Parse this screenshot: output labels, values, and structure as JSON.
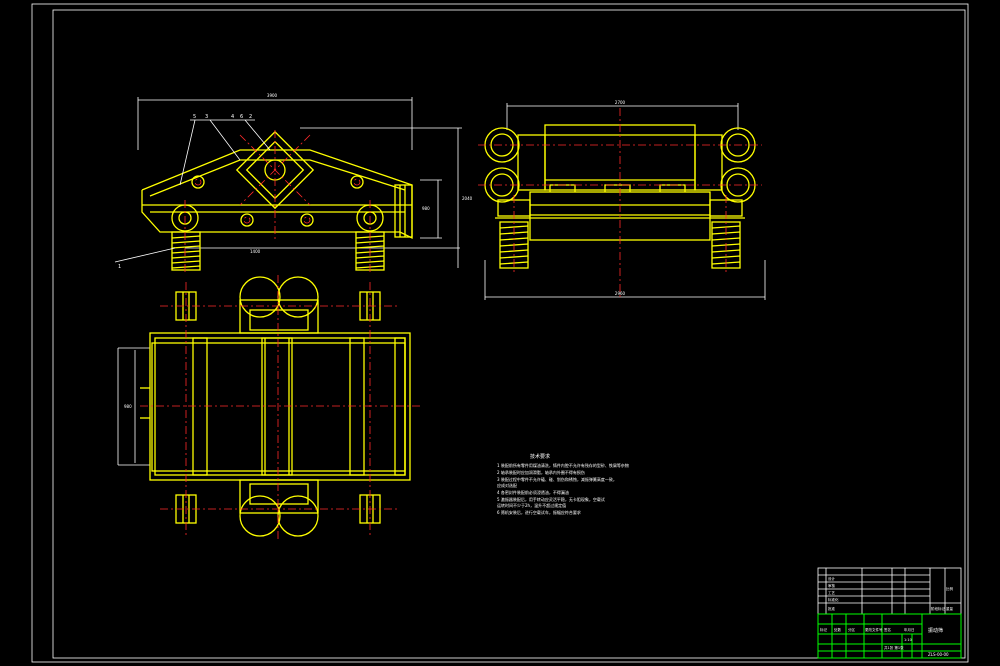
{
  "drawing": {
    "tech_title": "技术要求",
    "tech_notes": [
      "1  装配前所有零件用煤油清洗，铸件内腔不允许有残存的型砂、铁屑等杂物",
      "2  轴承装配时应加润滑脂，轴承内外圈不得有损伤",
      "3  装配过程中零件不允许磕、碰、划伤和锈蚀，减振弹簧高度一致，",
      "   应成对选配",
      "4  各密封件装配前必须浸透油，不得漏油",
      "5  激振器装配后，用手转动应灵活平稳，无卡阻现象，空载试",
      "   运转时间不少于2h，温升不超过规定值",
      "6  筛机安装后，进行空载试车，振幅应符合要求"
    ],
    "part_labels": [
      "5",
      "3",
      "4",
      "6",
      "2",
      "1"
    ],
    "dimensions": {
      "top_length": "3900",
      "width_span": "2700",
      "base_length": "1400",
      "height_total": "2040",
      "height_inner": "980",
      "bottom_width": "2960",
      "left_inner": "980"
    }
  },
  "title_block": {
    "drawing_name": "振动筛",
    "drawing_code": "ZLS-00-00",
    "scale": "1:10",
    "sheet_info": "共1张 第1张",
    "rows": [
      "标记",
      "处数",
      "分区",
      "更改文件号",
      "签名",
      "年月日"
    ],
    "roles": [
      "设计",
      "审核",
      "工艺",
      "标准化",
      "批准"
    ],
    "headers": [
      "阶段标记",
      "重量",
      "比例"
    ]
  }
}
